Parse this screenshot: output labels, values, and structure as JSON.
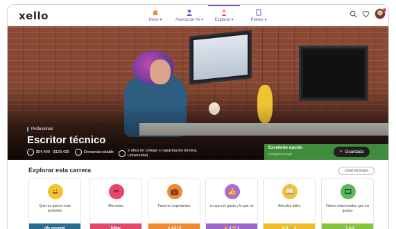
{
  "app": {
    "logo": "xello"
  },
  "nav": {
    "items": [
      {
        "label": "Inicio ▾",
        "icon": "home-icon",
        "active": false
      },
      {
        "label": "Acerca de mí ▾",
        "icon": "person-icon",
        "active": false
      },
      {
        "label": "Explorar ▾",
        "icon": "compass-person-icon",
        "active": true
      },
      {
        "label": "Planes ▾",
        "icon": "document-icon",
        "active": false
      }
    ],
    "right_icons": [
      "search-icon",
      "heart-icon",
      "avatar"
    ]
  },
  "hero": {
    "tag": "Profesiones",
    "title": "Escritor técnico",
    "stats": [
      {
        "icon": "salary-icon",
        "text": "$54,400 - $130,430"
      },
      {
        "icon": "demand-icon",
        "text": "Demanda estable"
      },
      {
        "icon": "education-icon",
        "text": "2 años en college o capacitación técnica, Universidad"
      }
    ],
    "match": {
      "title": "Excelente opción",
      "subtitle": "Averigua por qué"
    },
    "save_label": "Guardada"
  },
  "explore": {
    "title": "Explorar esta carrera",
    "compare_label": "Crear mi propio",
    "cards": [
      {
        "label": "Qué me parece esta profesión",
        "icon": "smiley-icon",
        "icon_glyph": "😀",
        "circle_color": "#f5c330",
        "bar_text": "¡Me encanta!",
        "bar_color": "#2a6c8e"
      },
      {
        "label": "Mis notas",
        "icon": "pencil-icon",
        "icon_glyph": "✏",
        "circle_color": "#e8456b",
        "bar_text": "Editar",
        "bar_color": "#e24a6c"
      },
      {
        "label": "Factores importantes",
        "icon": "briefcase-icon",
        "icon_glyph": "💼",
        "circle_color": "#f08a2e",
        "bar_text": "★ 4.2 / 5",
        "bar_color": "#ee8a30"
      },
      {
        "label": "Lo que me gusta y lo que no",
        "icon": "thumbs-icon",
        "icon_glyph": "👍",
        "circle_color": "#a96fd6",
        "bar_text": "👍 3  👎 1",
        "bar_color": "#9b67c9"
      },
      {
        "label": "Artículos útiles",
        "icon": "book-icon",
        "icon_glyph": "📖",
        "circle_color": "#f2c230",
        "bar_text": "⊙ 0  🔗 1",
        "bar_color": "#f0be2a"
      },
      {
        "label": "Videos relacionados que me gustan",
        "icon": "video-icon",
        "icon_glyph": "🎞",
        "circle_color": "#5cb85c",
        "bar_text": "🔗 1  ⊙ 0",
        "bar_color": "#86c43c"
      }
    ]
  }
}
